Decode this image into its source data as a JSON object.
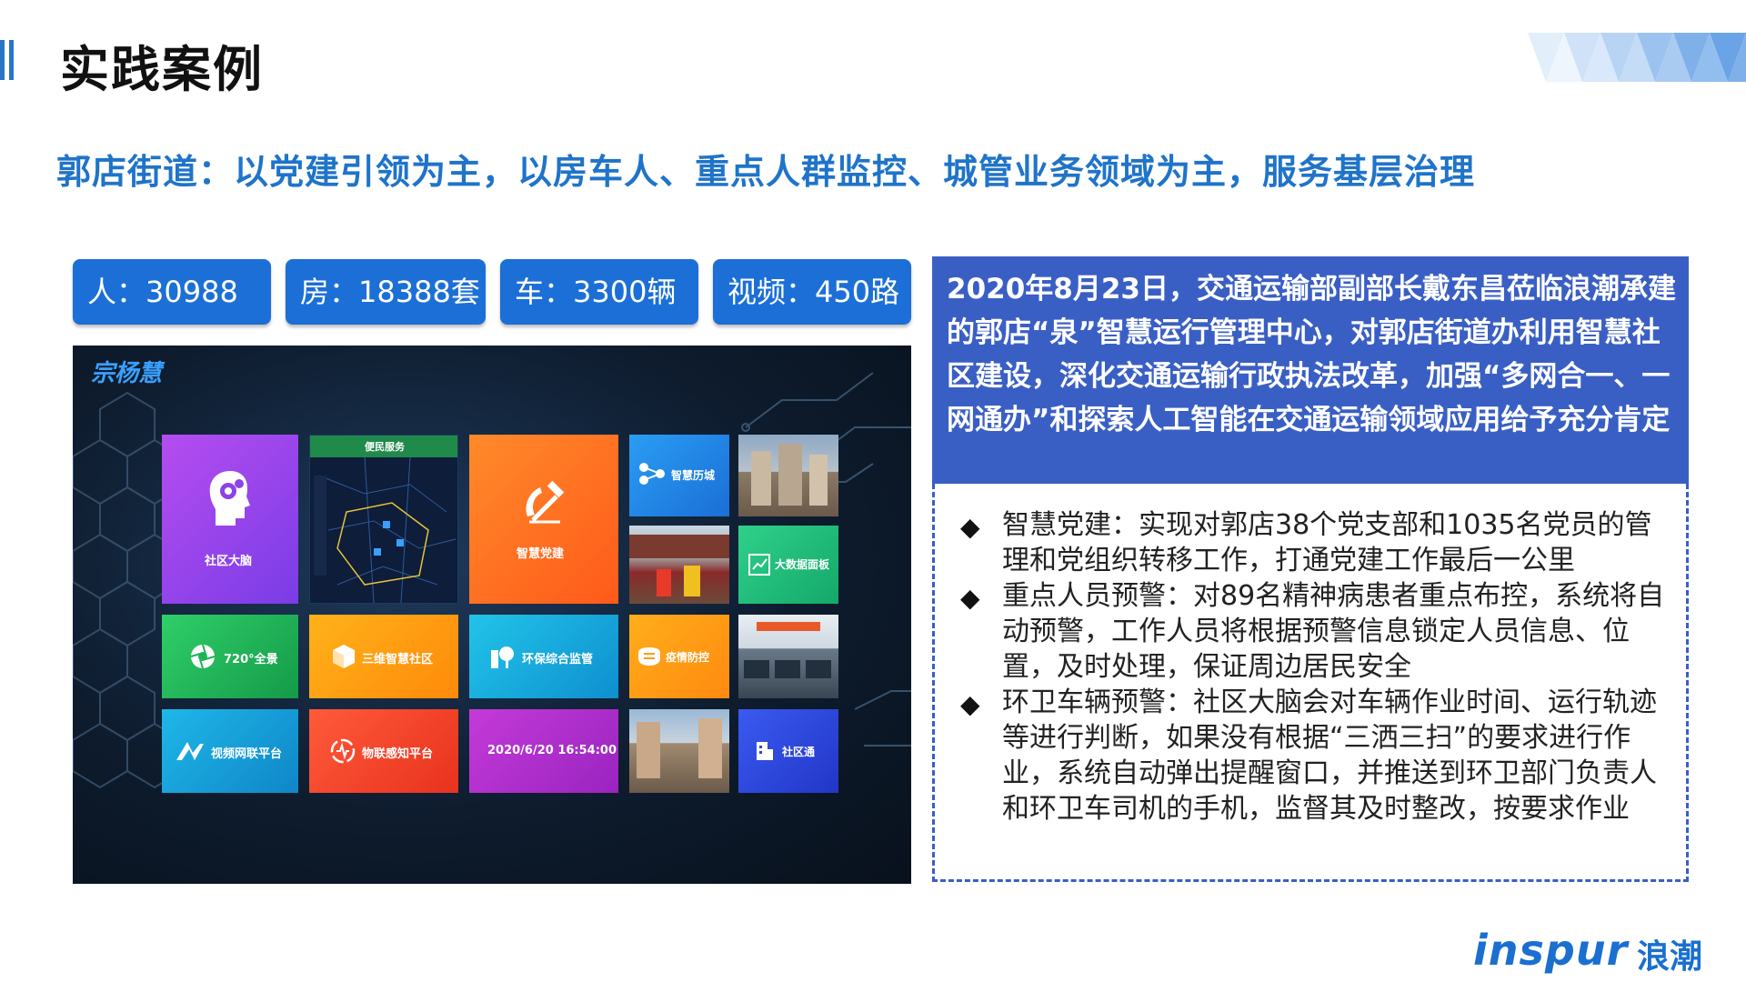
{
  "title": "实践案例",
  "subtitle": "郭店街道：以党建引领为主，以房车人、重点人群监控、城管业务领域为主，服务基层治理",
  "stats": [
    {
      "label": "人：30988"
    },
    {
      "label": "房：18388套"
    },
    {
      "label": "车：3300辆"
    },
    {
      "label": "视频：450路"
    }
  ],
  "screen": {
    "logo": "宗杨慧",
    "tiles": {
      "community_brain": "社区大脑",
      "convenience": "便民服务",
      "party": "智慧党建",
      "smart_licheng": "智慧历城",
      "big_data": "大数据面板",
      "panorama": "720°全景",
      "community_3d": "三维智慧社区",
      "env": "环保综合监管",
      "epidemic": "疫情防控",
      "video": "视频网联平台",
      "iot": "物联感知平台",
      "datetime": "2020/6/20 16:54:00",
      "shequtong": "社区通"
    }
  },
  "info": {
    "headline": "2020年8月23日，交通运输部副部长戴东昌莅临浪潮承建的郭店“泉”智慧运行管理中心，对郭店街道办利用智慧社区建设，深化交通运输行政执法改革，加强“多网合一、一网通办”和探索人工智能在交通运输领域应用给予充分肯定",
    "bullets": [
      "智慧党建：实现对郭店38个党支部和1035名党员的管理和党组织转移工作，打通党建工作最后一公里",
      "重点人员预警：对89名精神病患者重点布控，系统将自动预警，工作人员将根据预警信息锁定人员信息、位置，及时处理，保证周边居民安全",
      "环卫车辆预警：社区大脑会对车辆作业时间、运行轨迹等进行判断，如果没有根据“三洒三扫”的要求进行作业，系统自动弹出提醒窗口，并推送到环卫部门负责人和环卫车司机的手机，监督其及时整改，按要求作业"
    ],
    "bullet_symbol": "◆"
  },
  "logo": {
    "en": "inspur",
    "cn": "浪潮"
  },
  "colors": {
    "accent": "#1f74c9",
    "panel": "#3a5fc4",
    "stat": "#1c6fd6"
  }
}
